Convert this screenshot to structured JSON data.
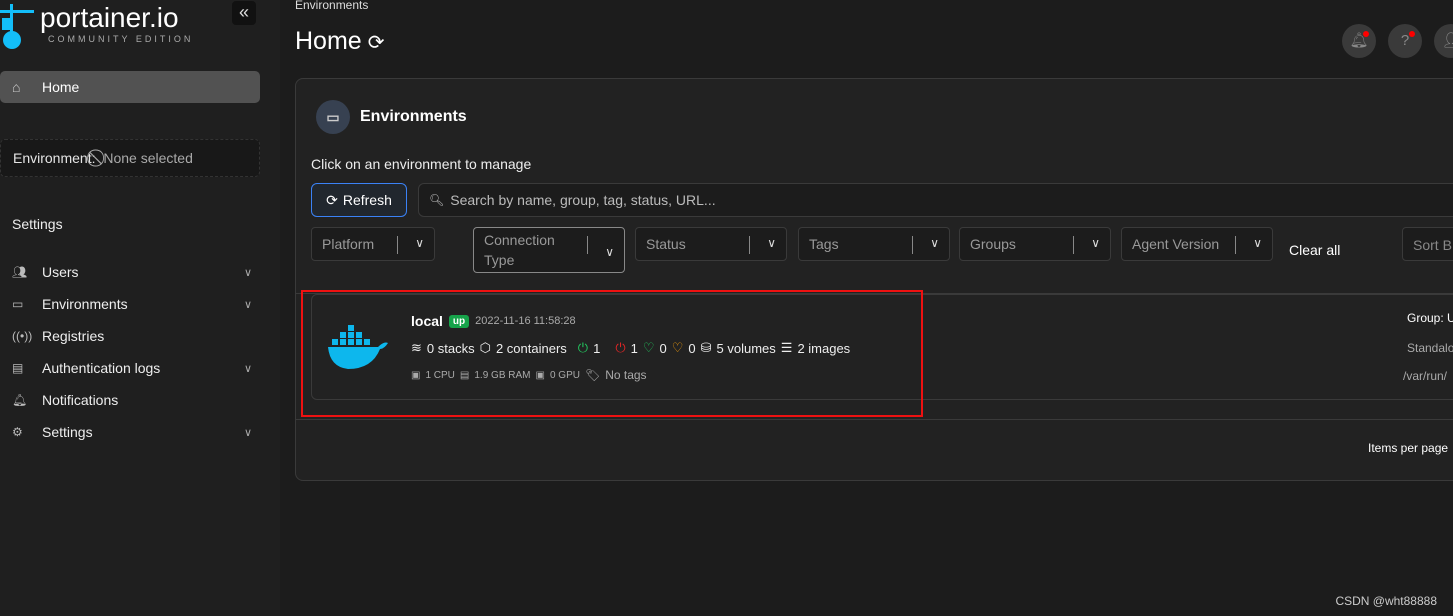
{
  "sidebar": {
    "logo": "portainer.io",
    "logo_sub": "COMMUNITY EDITION",
    "collapse": "«",
    "home": "Home",
    "env_label": "Environment:",
    "env_value": "None selected",
    "settings_heading": "Settings",
    "items": [
      {
        "label": "Users",
        "icon": "users-icon",
        "chevron": true
      },
      {
        "label": "Environments",
        "icon": "hdd-icon",
        "chevron": true
      },
      {
        "label": "Registries",
        "icon": "radio-icon",
        "chevron": false
      },
      {
        "label": "Authentication logs",
        "icon": "file-icon",
        "chevron": true
      },
      {
        "label": "Notifications",
        "icon": "bell-icon",
        "chevron": false
      },
      {
        "label": "Settings",
        "icon": "gear-icon",
        "chevron": true
      }
    ]
  },
  "header": {
    "breadcrumb": "Environments",
    "title": "Home"
  },
  "panel": {
    "title": "Environments",
    "hint": "Click on an environment to manage",
    "refresh": "Refresh",
    "search_placeholder": "Search by name, group, tag, status, URL...",
    "filters": [
      "Platform",
      "Connection Type",
      "Status",
      "Tags",
      "Groups",
      "Agent Version"
    ],
    "clear_all": "Clear all",
    "sort": "Sort B",
    "items_per_page": "Items per page"
  },
  "environment": {
    "name": "local",
    "status": "up",
    "timestamp": "2022-11-16 11:58:28",
    "stacks": "0 stacks",
    "containers": "2 containers",
    "running": "1",
    "stopped": "1",
    "healthy": "0",
    "unhealthy": "0",
    "volumes": "5 volumes",
    "images": "2 images",
    "cpu": "1 CPU",
    "ram": "1.9 GB RAM",
    "gpu": "0 GPU",
    "tags": "No tags",
    "group": "Group: U",
    "type": "Standalo",
    "url": "/var/run/"
  },
  "colors": {
    "accent": "#3b82f6",
    "up": "#16a34a",
    "running": "#22c55e",
    "stopped": "#dc2626",
    "healthy": "#22c55e",
    "unhealthy": "#f59e0b",
    "docker": "#0db7ed"
  },
  "watermark": "CSDN @wht88888"
}
